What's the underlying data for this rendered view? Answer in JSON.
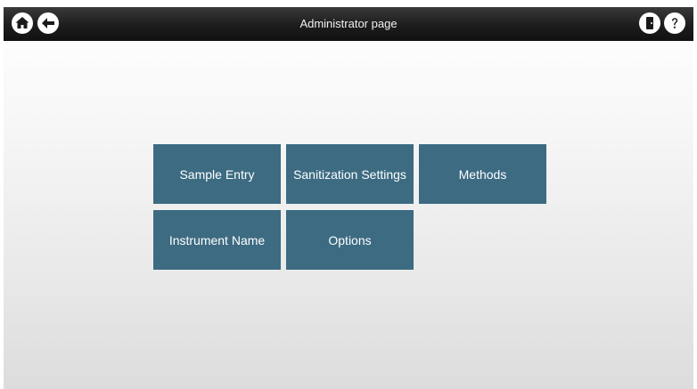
{
  "header": {
    "title": "Administrator page",
    "icons": {
      "home": "home-icon",
      "back": "back-arrow-icon",
      "logout": "logout-door-icon",
      "help": "help-icon"
    }
  },
  "menu": {
    "tiles": [
      {
        "label": "Sample Entry"
      },
      {
        "label": "Sanitization Settings"
      },
      {
        "label": "Methods"
      },
      {
        "label": "Instrument Name"
      },
      {
        "label": "Options"
      }
    ]
  },
  "colors": {
    "tile": "#3c6b82",
    "topbar": "#1c1c1c"
  }
}
